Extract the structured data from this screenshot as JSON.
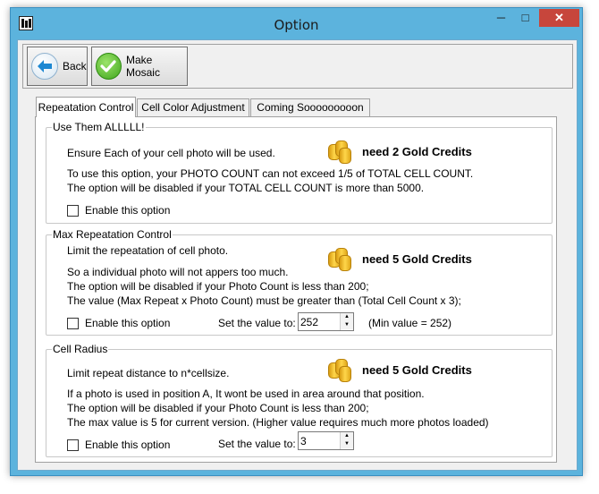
{
  "window": {
    "title": "Option"
  },
  "titlebar": {
    "minimize": "─",
    "maximize": "□",
    "close": "✕"
  },
  "toolbar": {
    "back_label": "Back",
    "mosaic_label": "Make Mosaic"
  },
  "tabs": [
    {
      "label": "Repeatation Control"
    },
    {
      "label": "Cell Color Adjustment"
    },
    {
      "label": "Coming Sooooooooon"
    }
  ],
  "groups": {
    "use_them": {
      "legend": "Use Them ALLLLL!",
      "lines": [
        "Ensure Each of your cell photo will be used.",
        "To use this option, your PHOTO COUNT can not exceed 1/5 of TOTAL CELL COUNT.",
        "The option will be disabled if your TOTAL CELL COUNT is more than 5000."
      ],
      "credit": "need 2 Gold Credits",
      "enable_label": "Enable this option"
    },
    "max_repeat": {
      "legend": "Max Repeatation Control",
      "lines": [
        "Limit the repeatation of cell photo.",
        "So a individual photo will not appers too much.",
        "The option will be disabled if your Photo Count is less than 200;",
        "The value (Max Repeat x Photo Count) must be greater than (Total Cell Count x 3);"
      ],
      "credit": "need 5 Gold Credits",
      "enable_label": "Enable this option",
      "set_label": "Set the value to:",
      "value": "252",
      "min_value": "(Min value = 252)"
    },
    "cell_radius": {
      "legend": "Cell Radius",
      "lines": [
        "Limit repeat distance to n*cellsize.",
        "If a photo is used in position A, It wont be used in area around that position.",
        "The option will be disabled if your Photo Count is less than 200;",
        "The max value is 5 for current version.  (Higher value requires much more photos loaded)"
      ],
      "credit": "need 5 Gold Credits",
      "enable_label": "Enable this option",
      "set_label": "Set the value to:",
      "value": "3"
    }
  },
  "icons": {
    "back": "arrow-left-icon",
    "mosaic": "checkmark-icon",
    "coins": "gold-coins-icon"
  },
  "colors": {
    "title_bar": "#5cb3dd",
    "close_button": "#c7463c",
    "back_arrow": "#1e88d2",
    "check_green": "#3fa51c",
    "coin_gold": "#f0b81e"
  }
}
